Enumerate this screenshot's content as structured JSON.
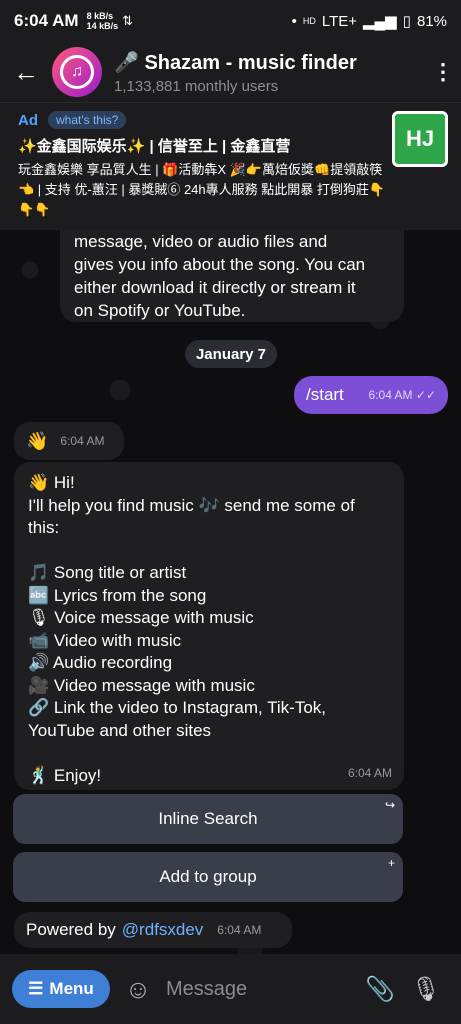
{
  "status": {
    "time": "6:04 AM",
    "speed_up": "8 kB/s",
    "speed_down": "14 kB/s",
    "network": "LTE+",
    "battery": "81%"
  },
  "header": {
    "title": "🎤 Shazam - music finder",
    "subtitle": "1,133,881 monthly users"
  },
  "ad": {
    "label": "Ad",
    "whats_this": "what's this?",
    "title": "✨金鑫国际娱乐✨ | 信誉至上 | 金鑫直营",
    "body": "玩金鑫娛樂 享品質人生 | 🎁活動犇X 🎉👉萬焙仮獎👊提領敲筷👈 | 支持 优-蕙汪 | 暴獎賊⑥ 24h專人服務 點此開暴 打倒狗莊👇👇👇",
    "logo_text": "HJ"
  },
  "messages": {
    "cut_text_1": "message, video or audio files and",
    "cut_text_2": "gives you info about the song. You can",
    "cut_text_3": "either download it directly or stream it",
    "cut_text_4": "on Spotify or YouTube.",
    "date_chip": "January 7",
    "outgoing_text": "/start",
    "outgoing_time": "6:04 AM",
    "wave_emoji": "👋",
    "wave_time": "6:04 AM",
    "help_lines": [
      "👋 Hi!",
      "I'll help you find music 🎶 send me some of",
      "this:",
      "",
      "🎵 Song title or artist",
      "🔤 Lyrics from the song",
      "🎙 Voice message with music",
      "📹 Video with music",
      "🔊 Audio recording",
      "🎥 Video message with music",
      "🔗 Link the video to Instagram, Tik-Tok,",
      "YouTube and other sites",
      "",
      "🕺 Enjoy!"
    ],
    "help_time": "6:04 AM",
    "powered_prefix": "Powered by",
    "powered_link": "@rdfsxdev",
    "powered_time": "6:04 AM"
  },
  "keyboard": {
    "inline_search": "Inline Search",
    "add_to_group": "Add to group"
  },
  "input": {
    "menu_label": "Menu",
    "placeholder": "Message"
  }
}
